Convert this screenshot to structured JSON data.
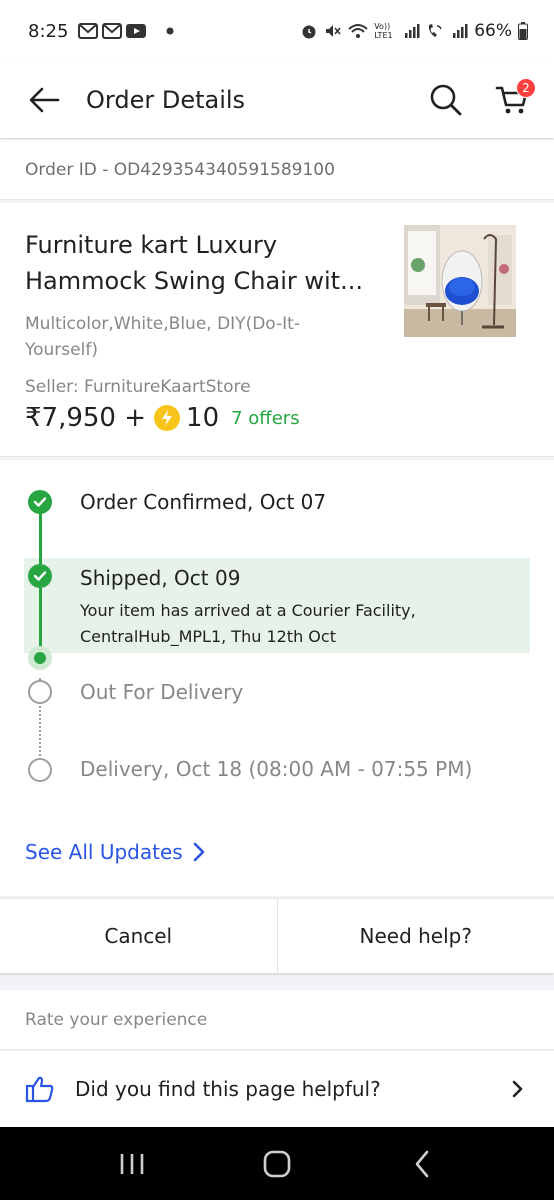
{
  "status_bar": {
    "time": "8:25",
    "battery": "66%",
    "icons": [
      "gmail-icon",
      "gmail-icon",
      "youtube-icon",
      "dot-icon",
      "alarm-icon",
      "mute-icon",
      "wifi-icon",
      "volte-icon",
      "signal-icon",
      "wifi-call-icon",
      "signal-icon",
      "battery-icon"
    ],
    "volte_label": "Vo)) LTE1"
  },
  "header": {
    "title": "Order Details",
    "cart_count": "2"
  },
  "order": {
    "id_label": "Order ID - OD429354340591589100"
  },
  "product": {
    "name": "Furniture kart Luxury Hammock Swing Chair wit...",
    "variant": "Multicolor,White,Blue, DIY(Do-It-Yourself)",
    "seller": "Seller: FurnitureKaartStore",
    "price": "₹7,950 +",
    "coins": "10",
    "offers": "7 offers"
  },
  "timeline": {
    "steps": [
      {
        "label": "Order Confirmed, Oct 07",
        "state": "done"
      },
      {
        "label": "Shipped, Oct 09",
        "state": "done",
        "detail_line1": "Your item has arrived at a Courier Facility,",
        "detail_line2": "CentralHub_MPL1, Thu 12th Oct"
      },
      {
        "label": "Out For Delivery",
        "state": "pending"
      },
      {
        "label": "Delivery, Oct 18 (08:00 AM - 07:55 PM)",
        "state": "pending"
      }
    ],
    "see_all": "See All Updates"
  },
  "actions": {
    "cancel": "Cancel",
    "help": "Need help?"
  },
  "feedback": {
    "rate_label": "Rate your experience",
    "helpful_question": "Did you find this page helpful?"
  },
  "colors": {
    "accent_green": "#26a541",
    "link_blue": "#2a55e5",
    "badge_red": "#ff3f3f",
    "highlight_green": "#e7f3e8"
  }
}
